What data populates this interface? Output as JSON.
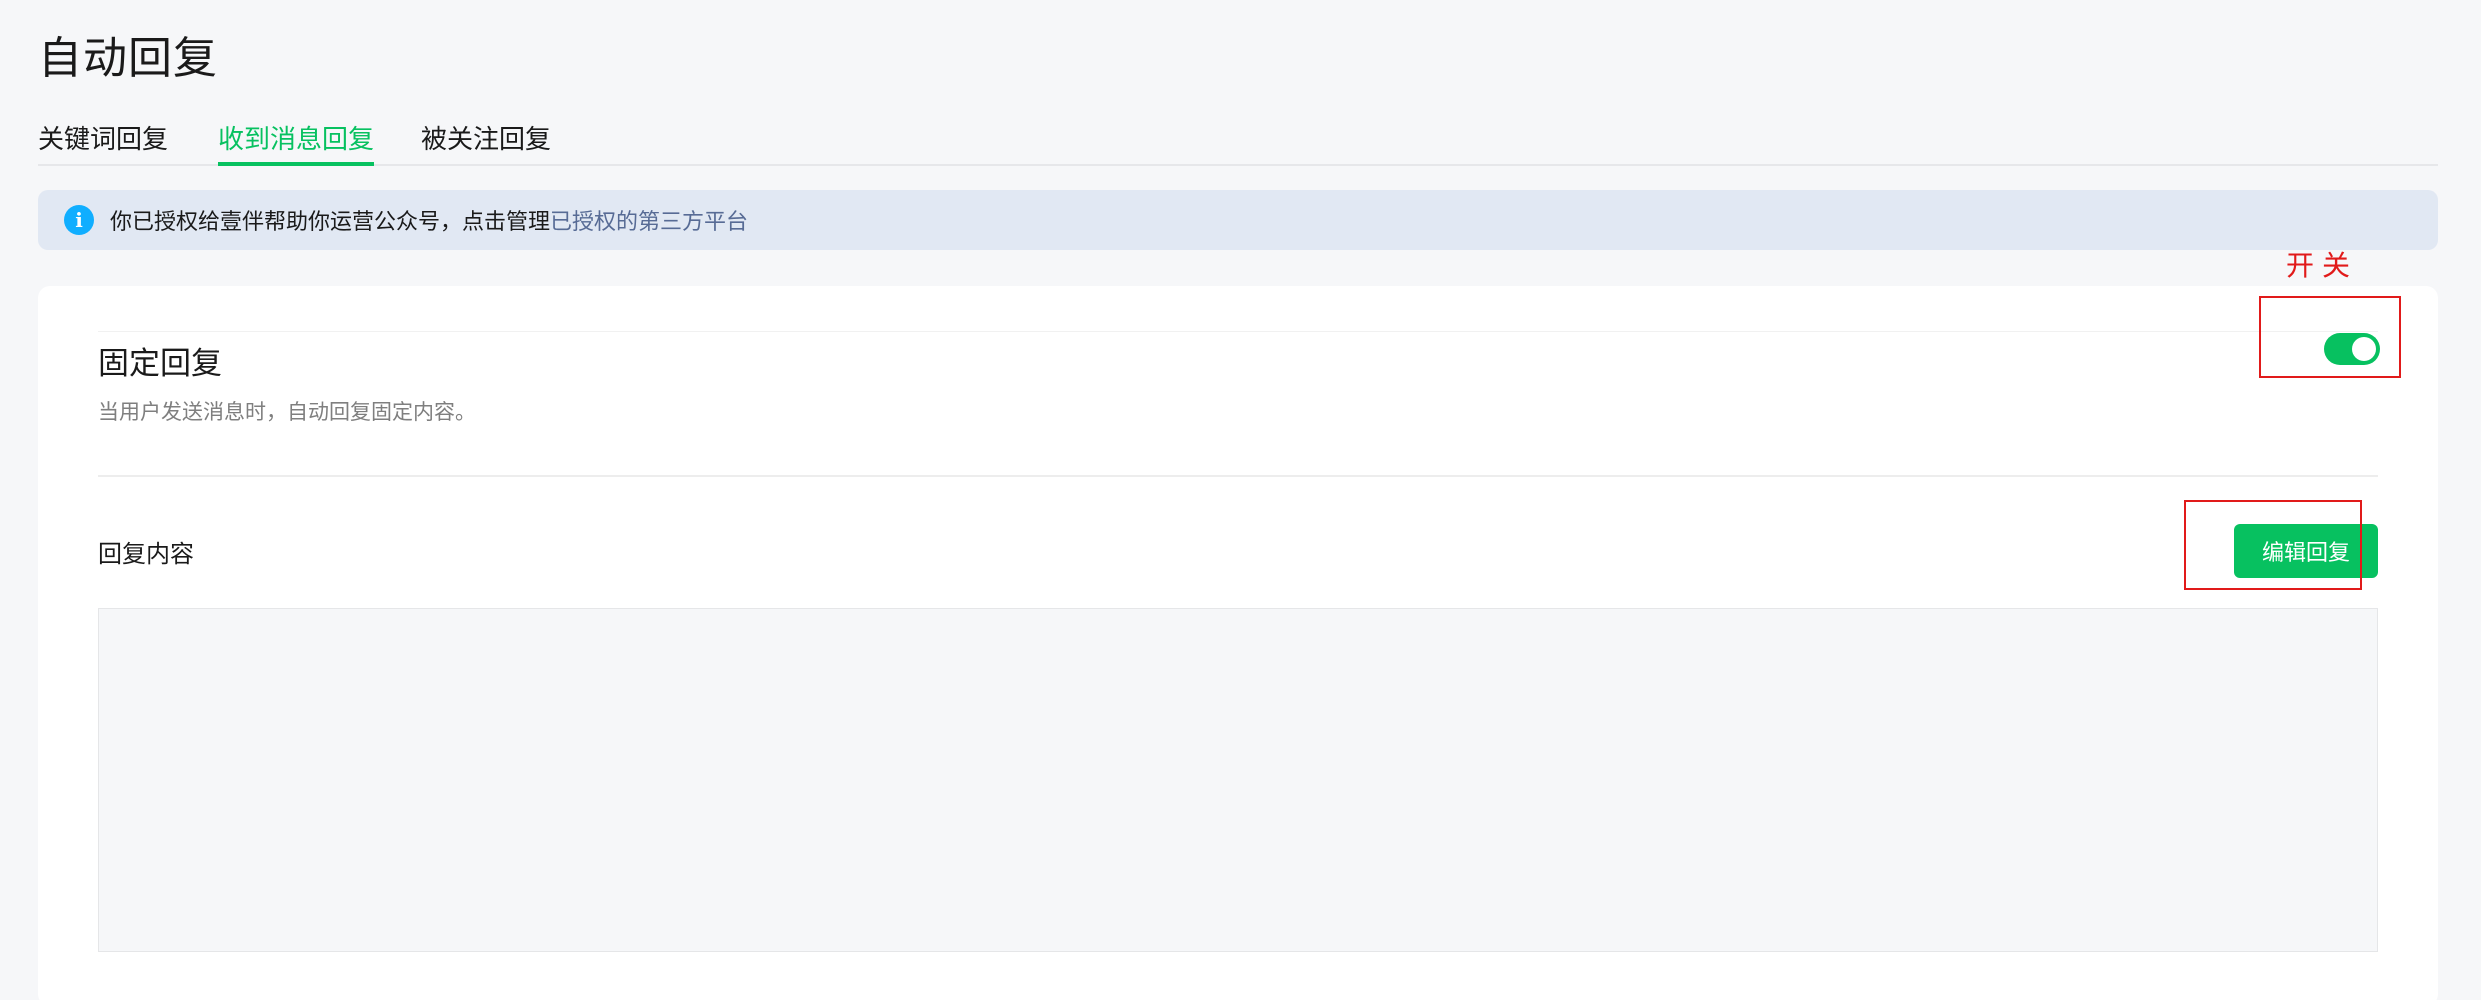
{
  "page": {
    "title": "自动回复"
  },
  "tabs": [
    {
      "label": "关键词回复",
      "active": false
    },
    {
      "label": "收到消息回复",
      "active": true
    },
    {
      "label": "被关注回复",
      "active": false
    }
  ],
  "notice": {
    "icon": "info-icon",
    "icon_glyph": "i",
    "text": "你已授权给壹伴帮助你运营公众号，点击管理",
    "link_text": "已授权的第三方平台"
  },
  "fixed_reply": {
    "title": "固定回复",
    "description": "当用户发送消息时，自动回复固定内容。",
    "enabled": true
  },
  "reply_content": {
    "label": "回复内容",
    "edit_button": "编辑回复"
  },
  "annotation": {
    "switch_label": "开关"
  },
  "colors": {
    "accent": "#07c160",
    "link": "#576b95",
    "info": "#10aeff",
    "annotation": "#e11a1a",
    "notice_bg": "#e1e8f3"
  }
}
